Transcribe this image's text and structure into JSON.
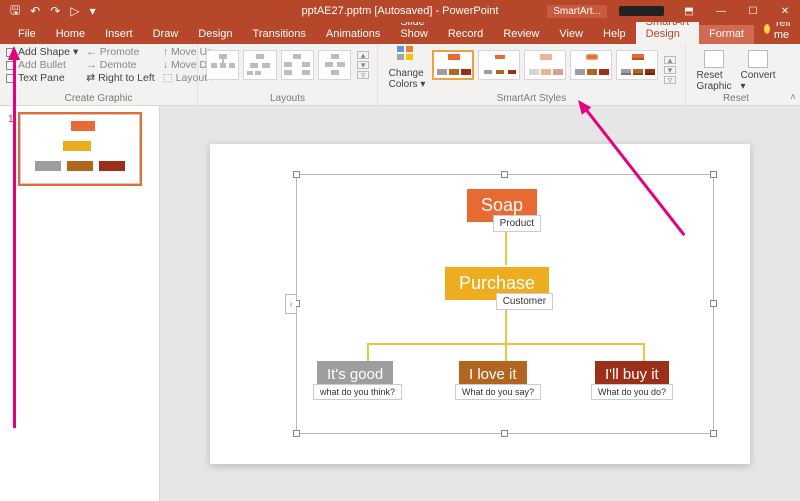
{
  "titlebar": {
    "doc_title": "pptAE27.pptm [Autosaved] - PowerPoint",
    "context_tab": "SmartArt...",
    "qat": {
      "save": "🖫",
      "undo": "↶",
      "redo": "↷",
      "start": "▷",
      "more": "▾"
    },
    "win": {
      "opts": "⬒",
      "min": "—",
      "max": "☐",
      "close": "✕"
    }
  },
  "tabs": {
    "file": "File",
    "home": "Home",
    "insert": "Insert",
    "draw": "Draw",
    "design": "Design",
    "transitions": "Transitions",
    "animations": "Animations",
    "slideshow": "Slide Show",
    "record": "Record",
    "review": "Review",
    "view": "View",
    "help": "Help",
    "smartart_design": "SmartArt Design",
    "format": "Format",
    "tell_me": "Tell me"
  },
  "ribbon": {
    "create_graphic": {
      "label": "Create Graphic",
      "add_shape": "Add Shape",
      "add_bullet": "Add Bullet",
      "text_pane": "Text Pane",
      "promote": "Promote",
      "demote": "Demote",
      "rtl": "Right to Left",
      "move_up": "Move Up",
      "move_down": "Move Down",
      "layout": "Layout"
    },
    "layouts": {
      "label": "Layouts"
    },
    "change_colors": {
      "line1": "Change",
      "line2": "Colors"
    },
    "styles": {
      "label": "SmartArt Styles"
    },
    "reset": {
      "label": "Reset",
      "reset_graphic1": "Reset",
      "reset_graphic2": "Graphic",
      "convert": "Convert"
    }
  },
  "slide_panel": {
    "num1": "1"
  },
  "smartart": {
    "n1": {
      "title": "Soap",
      "label": "Product",
      "color": "#e86a33"
    },
    "n2": {
      "title": "Purchase",
      "label": "Customer",
      "color": "#eead1e"
    },
    "n3": {
      "title": "It's good",
      "label": "what do you think?",
      "color": "#9e9e9e"
    },
    "n4": {
      "title": "I love it",
      "label": "What do you say?",
      "color": "#b2651f"
    },
    "n5": {
      "title": "I'll buy it",
      "label": "What do you do?",
      "color": "#9b2f1a"
    }
  },
  "styles_palette": {
    "s1": {
      "top": "#e86a33",
      "b1": "#9e9e9e",
      "b2": "#b2651f",
      "b3": "#9b2f1a"
    }
  },
  "chart_data": {
    "type": "hierarchy",
    "title": "",
    "nodes": [
      {
        "id": "soap",
        "title": "Soap",
        "subtitle": "Product",
        "level": 0,
        "color": "#e86a33"
      },
      {
        "id": "purchase",
        "title": "Purchase",
        "subtitle": "Customer",
        "level": 1,
        "parent": "soap",
        "color": "#eead1e"
      },
      {
        "id": "good",
        "title": "It's good",
        "subtitle": "what do you think?",
        "level": 2,
        "parent": "purchase",
        "color": "#9e9e9e"
      },
      {
        "id": "love",
        "title": "I love it",
        "subtitle": "What do you say?",
        "level": 2,
        "parent": "purchase",
        "color": "#b2651f"
      },
      {
        "id": "buy",
        "title": "I'll buy it",
        "subtitle": "What do you do?",
        "level": 2,
        "parent": "purchase",
        "color": "#9b2f1a"
      }
    ]
  }
}
